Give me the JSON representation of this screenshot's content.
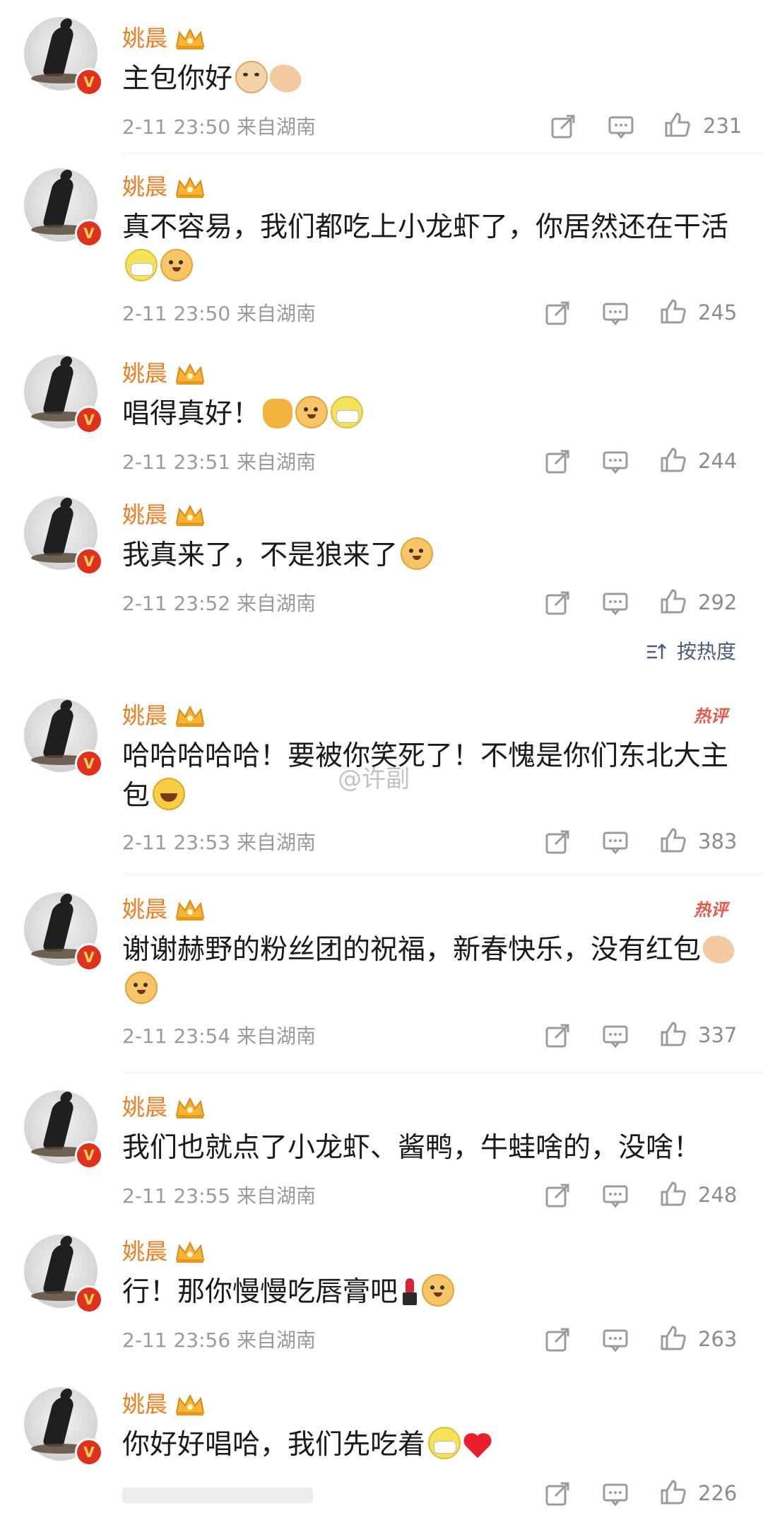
{
  "sort": {
    "label": "按热度"
  },
  "watermark": "@许副",
  "comments": [
    {
      "username": "姚晨",
      "text": "主包你好",
      "time": "2-11 23:50",
      "location": "来自湖南",
      "likes": "231",
      "hot": ""
    },
    {
      "username": "姚晨",
      "text": "真不容易，我们都吃上小龙虾了，你居然还在干活",
      "time": "2-11 23:50",
      "location": "来自湖南",
      "likes": "245",
      "hot": ""
    },
    {
      "username": "姚晨",
      "text": "唱得真好！",
      "time": "2-11 23:51",
      "location": "来自湖南",
      "likes": "244",
      "hot": ""
    },
    {
      "username": "姚晨",
      "text": "我真来了，不是狼来了",
      "time": "2-11 23:52",
      "location": "来自湖南",
      "likes": "292",
      "hot": ""
    },
    {
      "username": "姚晨",
      "text": "哈哈哈哈哈！要被你笑死了！不愧是你们东北大主包",
      "time": "2-11 23:53",
      "location": "来自湖南",
      "likes": "383",
      "hot": "热评"
    },
    {
      "username": "姚晨",
      "text": "谢谢赫野的粉丝团的祝福，新春快乐，没有红包",
      "time": "2-11 23:54",
      "location": "来自湖南",
      "likes": "337",
      "hot": "热评"
    },
    {
      "username": "姚晨",
      "text": "我们也就点了小龙虾、酱鸭，牛蛙啥的，没啥！",
      "time": "2-11 23:55",
      "location": "来自湖南",
      "likes": "248",
      "hot": ""
    },
    {
      "username": "姚晨",
      "text": "行！那你慢慢吃唇膏吧",
      "time": "2-11 23:56",
      "location": "来自湖南",
      "likes": "263",
      "hot": ""
    },
    {
      "username": "姚晨",
      "text": "你好好唱哈，我们先吃着",
      "time": "",
      "location": "",
      "likes": "226",
      "hot": ""
    }
  ],
  "icons": {
    "share": "share-icon",
    "reply": "comment-icon",
    "like": "thumbs-up-icon",
    "badge": "verified-v-icon",
    "crown": "crown-badge-icon"
  },
  "colors": {
    "username": "#ee7d22",
    "meta": "#9a9a9a",
    "hot_badge": "#e8584a",
    "sort_link": "#4b5d7a",
    "verified_badge": "#e0301e"
  }
}
